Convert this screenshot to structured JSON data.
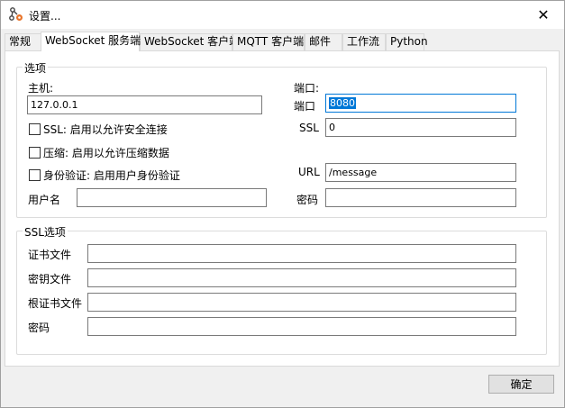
{
  "window": {
    "title": "设置...",
    "close_glyph": "✕"
  },
  "tabs": [
    {
      "label": "常规"
    },
    {
      "label": "WebSocket 服务端",
      "active": true
    },
    {
      "label": "WebSocket 客户端"
    },
    {
      "label": "MQTT 客户端"
    },
    {
      "label": "邮件"
    },
    {
      "label": "工作流"
    },
    {
      "label": "Python"
    }
  ],
  "options": {
    "group_title": "选项",
    "host_label": "主机:",
    "host_value": "127.0.0.1",
    "port_header": "端口:",
    "port_label": "端口",
    "port_value": "8080",
    "ssl_checkbox": "SSL: 启用以允许安全连接",
    "ssl_label": "SSL",
    "ssl_value": "0",
    "compress_checkbox": "压缩: 启用以允许压缩数据",
    "auth_checkbox": "身份验证: 启用用户身份验证",
    "url_label": "URL",
    "url_value": "/message",
    "username_label": "用户名",
    "username_value": "",
    "password_label": "密码",
    "password_value": ""
  },
  "ssl_options": {
    "group_title": "SSL选项",
    "cert_label": "证书文件",
    "cert_value": "",
    "key_label": "密钥文件",
    "key_value": "",
    "root_cert_label": "根证书文件",
    "root_cert_value": "",
    "password_label": "密码",
    "password_value": ""
  },
  "footer": {
    "ok_label": "确定"
  },
  "colors": {
    "accent": "#0078d7",
    "icon_orange": "#e8742a"
  }
}
